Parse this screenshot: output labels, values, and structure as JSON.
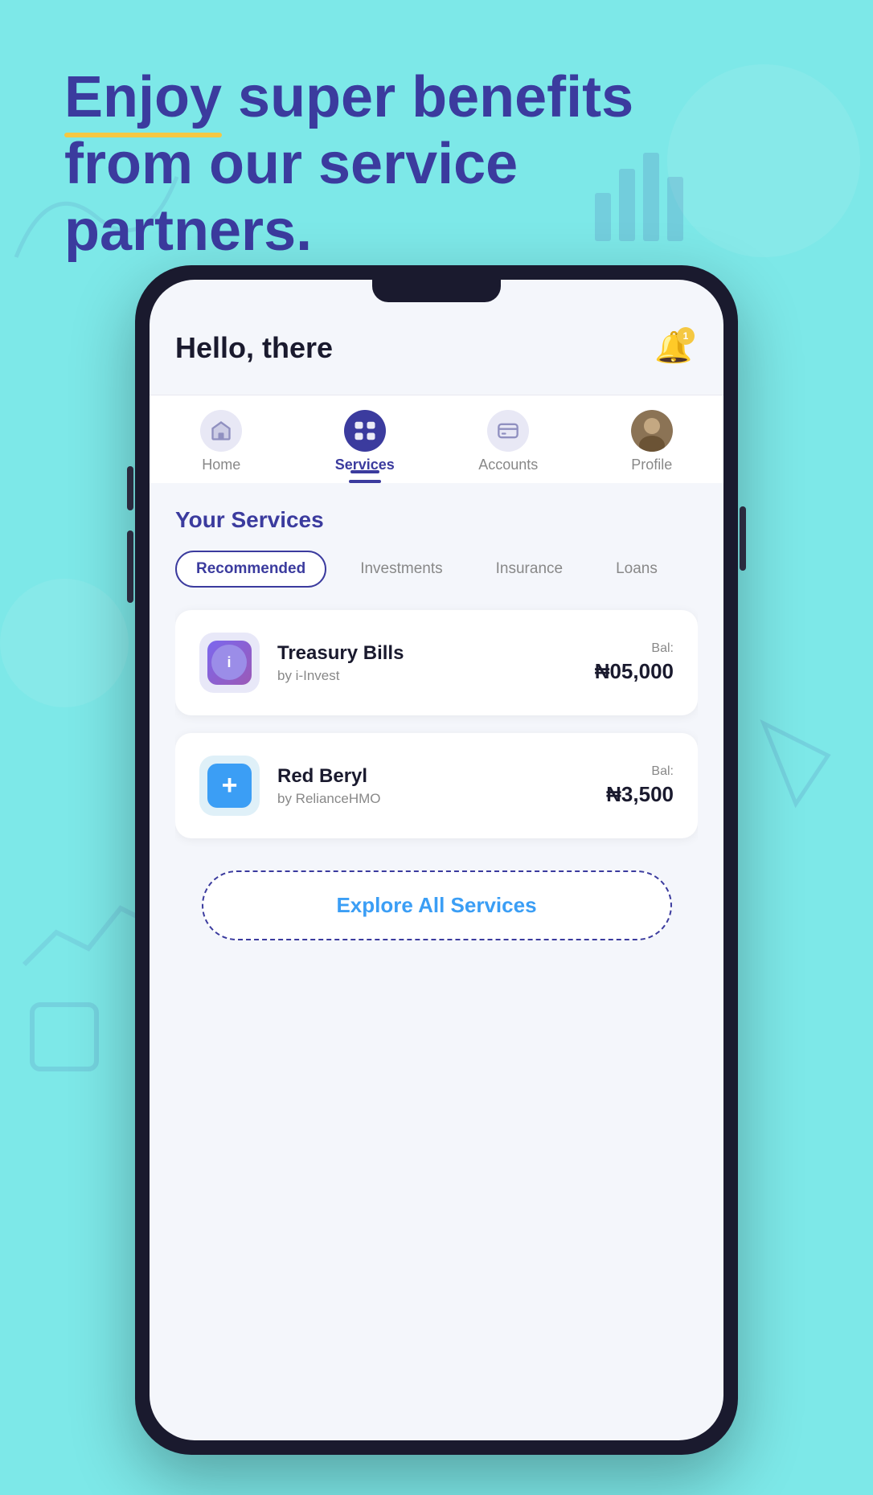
{
  "background": {
    "color": "#7de8e8"
  },
  "hero": {
    "title_part1": "Enjoy",
    "title_part2": " super benefits",
    "title_line2": "from our service",
    "title_line3": "partners."
  },
  "app": {
    "greeting": "Hello, there",
    "notification_badge": "1"
  },
  "nav": {
    "items": [
      {
        "id": "home",
        "label": "Home",
        "icon": "🏠",
        "active": false
      },
      {
        "id": "services",
        "label": "Services",
        "icon": "🎴",
        "active": true
      },
      {
        "id": "accounts",
        "label": "Accounts",
        "icon": "💳",
        "active": false
      },
      {
        "id": "profile",
        "label": "Profile",
        "icon": "",
        "active": false
      }
    ]
  },
  "services": {
    "section_title": "Your Services",
    "filters": [
      {
        "label": "Recommended",
        "active": true
      },
      {
        "label": "Investments",
        "active": false
      },
      {
        "label": "Insurance",
        "active": false
      },
      {
        "label": "Loans",
        "active": false
      }
    ],
    "items": [
      {
        "name": "Treasury Bills",
        "provider": "by i-Invest",
        "balance_label": "Bal:",
        "balance": "₦05,000",
        "logo_type": "iinvest",
        "logo_text": "i"
      },
      {
        "name": "Red Beryl",
        "provider": "by RelianceHMO",
        "balance_label": "Bal:",
        "balance": "₦3,500",
        "logo_type": "redberyl",
        "logo_text": "+"
      }
    ],
    "explore_button": "Explore All Services"
  }
}
